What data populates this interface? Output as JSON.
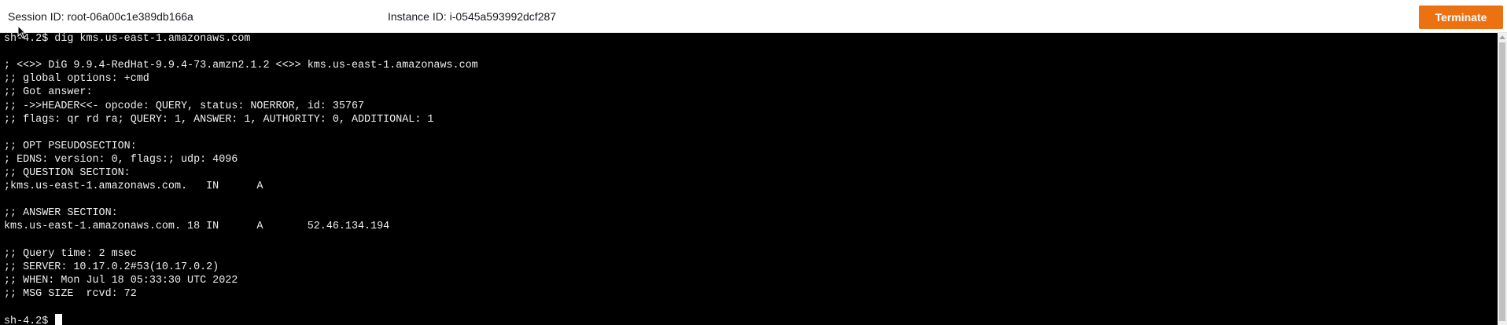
{
  "header": {
    "session_text": "Session ID: root-06a00c1e389db166a",
    "instance_text": "Instance ID: i-0545a593992dcf287",
    "terminate_label": "Terminate"
  },
  "terminal": {
    "lines": [
      "sh-4.2$ dig kms.us-east-1.amazonaws.com",
      "",
      "; <<>> DiG 9.9.4-RedHat-9.9.4-73.amzn2.1.2 <<>> kms.us-east-1.amazonaws.com",
      ";; global options: +cmd",
      ";; Got answer:",
      ";; ->>HEADER<<- opcode: QUERY, status: NOERROR, id: 35767",
      ";; flags: qr rd ra; QUERY: 1, ANSWER: 1, AUTHORITY: 0, ADDITIONAL: 1",
      "",
      ";; OPT PSEUDOSECTION:",
      "; EDNS: version: 0, flags:; udp: 4096",
      ";; QUESTION SECTION:",
      ";kms.us-east-1.amazonaws.com.   IN      A",
      "",
      ";; ANSWER SECTION:",
      "kms.us-east-1.amazonaws.com. 18 IN      A       52.46.134.194",
      "",
      ";; Query time: 2 msec",
      ";; SERVER: 10.17.0.2#53(10.17.0.2)",
      ";; WHEN: Mon Jul 18 05:33:30 UTC 2022",
      ";; MSG SIZE  rcvd: 72",
      "",
      "sh-4.2$ "
    ]
  },
  "colors": {
    "terminate_button": "#ec7211",
    "terminal_background": "#000000",
    "terminal_text": "#f0f0f0"
  },
  "icons": {
    "mouse": "mouse-pointer-icon",
    "scroll_up": "scroll-up-arrow-icon"
  }
}
